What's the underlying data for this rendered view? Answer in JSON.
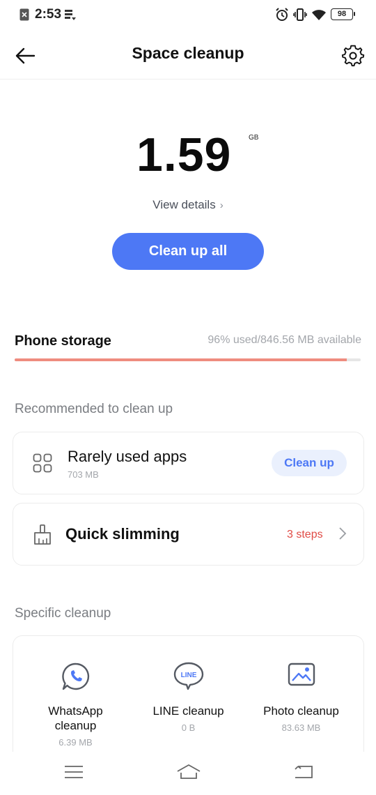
{
  "status_bar": {
    "time": "2:53",
    "battery": "98",
    "icons": [
      "notification-x-icon",
      "data-saver-icon",
      "alarm-icon",
      "vibrate-icon",
      "wifi-icon",
      "battery-icon"
    ]
  },
  "header": {
    "title": "Space cleanup",
    "back_icon": "arrow-left-icon",
    "settings_icon": "gear-icon"
  },
  "summary": {
    "size": "1.59",
    "unit": "GB",
    "view_details": "View details",
    "clean_all_label": "Clean up all"
  },
  "storage": {
    "label": "Phone storage",
    "status": "96% used/846.56 MB available",
    "used_fraction": 0.96,
    "bar_color": "#ef8c7f"
  },
  "recommended": {
    "heading": "Recommended to clean up",
    "rarely_used": {
      "title": "Rarely used apps",
      "size": "703 MB",
      "button_label": "Clean up",
      "icon": "apps-grid-icon"
    },
    "quick_slimming": {
      "title": "Quick slimming",
      "steps": "3 steps",
      "icon": "broom-icon"
    }
  },
  "specific": {
    "heading": "Specific cleanup",
    "items": [
      {
        "title_line1": "WhatsApp",
        "title_line2": "cleanup",
        "size": "6.39 MB",
        "icon": "whatsapp-icon"
      },
      {
        "title_line1": "LINE cleanup",
        "title_line2": "",
        "size": "0 B",
        "icon": "line-icon",
        "icon_text": "LINE"
      },
      {
        "title_line1": "Photo cleanup",
        "title_line2": "",
        "size": "83.63 MB",
        "icon": "photo-icon"
      }
    ]
  },
  "colors": {
    "accent": "#4d78f5",
    "warning": "#e04b45",
    "muted": "#a3a6ab"
  },
  "bottom_nav": {
    "icons": [
      "menu-icon",
      "home-icon",
      "back-nav-icon"
    ]
  }
}
